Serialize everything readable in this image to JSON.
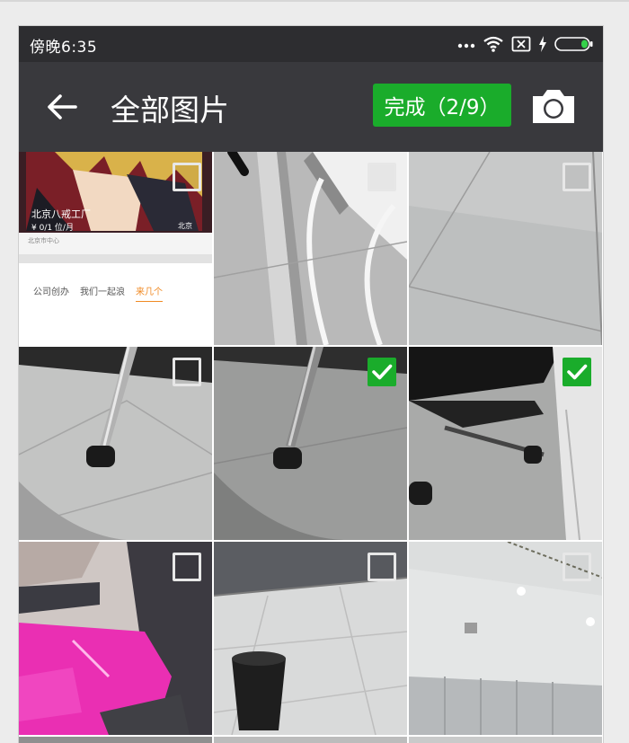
{
  "status_bar": {
    "time": "傍晚6:35",
    "icons": [
      "more-dots-icon",
      "wifi-icon",
      "sim-off-icon",
      "charging-bolt-icon",
      "battery-icon"
    ]
  },
  "header": {
    "back_icon": "arrow-left-icon",
    "title": "全部图片",
    "done_button": "完成（2/9）",
    "camera_icon": "camera-icon"
  },
  "gallery": {
    "photos": [
      {
        "content": "screenshot-card",
        "selected": false
      },
      {
        "content": "white-cable-table-leg",
        "selected": false
      },
      {
        "content": "floor-tiles",
        "selected": false
      },
      {
        "content": "chair-wheel",
        "selected": false
      },
      {
        "content": "chair-wheel",
        "selected": true
      },
      {
        "content": "office-chair-table",
        "selected": true
      },
      {
        "content": "pink-chair",
        "selected": false
      },
      {
        "content": "office-floor-bin",
        "selected": false
      },
      {
        "content": "office-ceiling",
        "selected": false
      }
    ],
    "screenshot_card": {
      "title": "北京八戒工厂",
      "price": "¥ 0/1 位/月",
      "city": "北京",
      "location": "北京市中心",
      "tabs": [
        "公司创办",
        "我们一起浪",
        "来几个"
      ]
    }
  },
  "colors": {
    "status_bar": "#2d2d30",
    "app_bar": "#39393d",
    "accent_green": "#1aac2b",
    "page_background": "#ececec"
  }
}
